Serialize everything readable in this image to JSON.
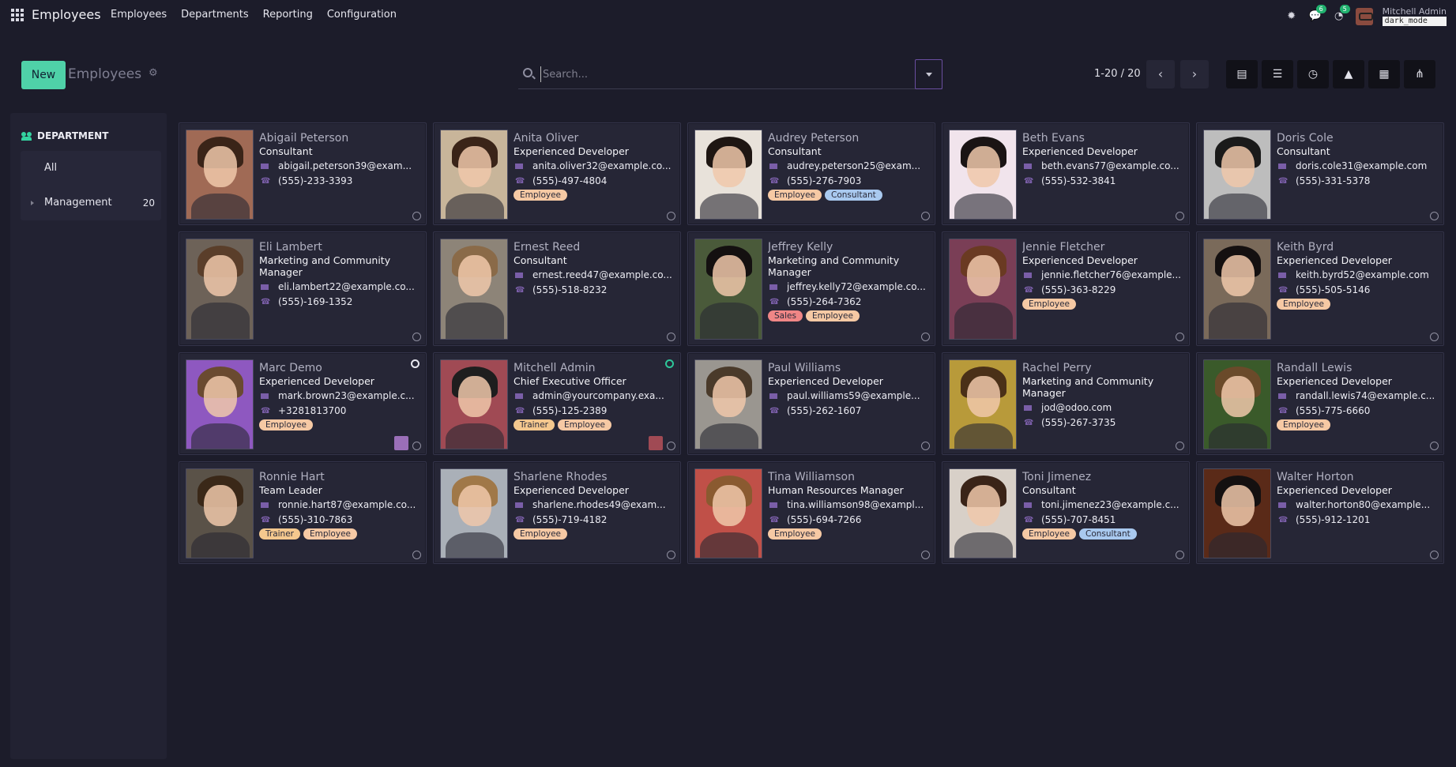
{
  "app": {
    "title": "Employees"
  },
  "top_menu": [
    "Employees",
    "Departments",
    "Reporting",
    "Configuration"
  ],
  "systray": {
    "messages_count": "6",
    "activities_count": "5",
    "user_name": "Mitchell Admin",
    "db_name": "dark_mode"
  },
  "control": {
    "new_label": "New",
    "breadcrumb": "Employees",
    "search_placeholder": "Search...",
    "pager": "1-20 / 20"
  },
  "sidepanel": {
    "header": "DEPARTMENT",
    "items": [
      {
        "label": "All",
        "count": ""
      },
      {
        "label": "Management",
        "count": "20"
      }
    ]
  },
  "employees": [
    {
      "name": "Abigail Peterson",
      "job": "Consultant",
      "email": "abigail.peterson39@exam...",
      "phone": "(555)-233-3393",
      "tags": [],
      "photo": "#a06a55",
      "hair": "#3a2418"
    },
    {
      "name": "Anita Oliver",
      "job": "Experienced Developer",
      "email": "anita.oliver32@example.co...",
      "phone": "(555)-497-4804",
      "tags": [
        "Employee"
      ],
      "photo": "#c8b59a",
      "hair": "#3a2418"
    },
    {
      "name": "Audrey Peterson",
      "job": "Consultant",
      "email": "audrey.peterson25@exam...",
      "phone": "(555)-276-7903",
      "tags": [
        "Employee",
        "Consultant"
      ],
      "photo": "#e8e2da",
      "hair": "#1e1612"
    },
    {
      "name": "Beth Evans",
      "job": "Experienced Developer",
      "email": "beth.evans77@example.co...",
      "phone": "(555)-532-3841",
      "tags": [],
      "photo": "#f1e4ec",
      "hair": "#1a1414"
    },
    {
      "name": "Doris Cole",
      "job": "Consultant",
      "email": "doris.cole31@example.com",
      "phone": "(555)-331-5378",
      "tags": [],
      "photo": "#bdbdbd",
      "hair": "#1a1a1a"
    },
    {
      "name": "Eli Lambert",
      "job": "Marketing and Community Manager",
      "email": "eli.lambert22@example.co...",
      "phone": "(555)-169-1352",
      "tags": [],
      "photo": "#6d6258",
      "hair": "#5a3e2a"
    },
    {
      "name": "Ernest Reed",
      "job": "Consultant",
      "email": "ernest.reed47@example.co...",
      "phone": "(555)-518-8232",
      "tags": [],
      "photo": "#8d8478",
      "hair": "#8a6a48"
    },
    {
      "name": "Jeffrey Kelly",
      "job": "Marketing and Community Manager",
      "email": "jeffrey.kelly72@example.co...",
      "phone": "(555)-264-7362",
      "tags": [
        "Sales",
        "Employee"
      ],
      "photo": "#4a5a3a",
      "hair": "#141010"
    },
    {
      "name": "Jennie Fletcher",
      "job": "Experienced Developer",
      "email": "jennie.fletcher76@example...",
      "phone": "(555)-363-8229",
      "tags": [
        "Employee"
      ],
      "photo": "#7a3e56",
      "hair": "#6a3a22"
    },
    {
      "name": "Keith Byrd",
      "job": "Experienced Developer",
      "email": "keith.byrd52@example.com",
      "phone": "(555)-505-5146",
      "tags": [
        "Employee"
      ],
      "photo": "#7a6a5a",
      "hair": "#141010"
    },
    {
      "name": "Marc Demo",
      "job": "Experienced Developer",
      "email": "mark.brown23@example.c...",
      "phone": "+3281813700",
      "tags": [
        "Employee"
      ],
      "photo": "#8e58c0",
      "hair": "#6a4a30",
      "presence": "offline",
      "mini": "#9a6fb8"
    },
    {
      "name": "Mitchell Admin",
      "job": "Chief Executive Officer",
      "email": "admin@yourcompany.exa...",
      "phone": "(555)-125-2389",
      "tags": [
        "Trainer",
        "Employee"
      ],
      "photo": "#a04a54",
      "hair": "#1e1e1e",
      "presence": "online",
      "mini": "#a04a54"
    },
    {
      "name": "Paul Williams",
      "job": "Experienced Developer",
      "email": "paul.williams59@example...",
      "phone": "(555)-262-1607",
      "tags": [],
      "photo": "#9a9690",
      "hair": "#4a3a2a"
    },
    {
      "name": "Rachel Perry",
      "job": "Marketing and Community Manager",
      "email": "jod@odoo.com",
      "phone": "(555)-267-3735",
      "tags": [],
      "photo": "#b89a3a",
      "hair": "#4a3018"
    },
    {
      "name": "Randall Lewis",
      "job": "Experienced Developer",
      "email": "randall.lewis74@example.c...",
      "phone": "(555)-775-6660",
      "tags": [
        "Employee"
      ],
      "photo": "#3a5a2a",
      "hair": "#6a4a2a"
    },
    {
      "name": "Ronnie Hart",
      "job": "Team Leader",
      "email": "ronnie.hart87@example.co...",
      "phone": "(555)-310-7863",
      "tags": [
        "Trainer",
        "Employee"
      ],
      "photo": "#5a5248",
      "hair": "#3a2818"
    },
    {
      "name": "Sharlene Rhodes",
      "job": "Experienced Developer",
      "email": "sharlene.rhodes49@exam...",
      "phone": "(555)-719-4182",
      "tags": [
        "Employee"
      ],
      "photo": "#aab0b8",
      "hair": "#a07848"
    },
    {
      "name": "Tina Williamson",
      "job": "Human Resources Manager",
      "email": "tina.williamson98@exampl...",
      "phone": "(555)-694-7266",
      "tags": [
        "Employee"
      ],
      "photo": "#c05048",
      "hair": "#8a5a30"
    },
    {
      "name": "Toni Jimenez",
      "job": "Consultant",
      "email": "toni.jimenez23@example.c...",
      "phone": "(555)-707-8451",
      "tags": [
        "Employee",
        "Consultant"
      ],
      "photo": "#d8d0c8",
      "hair": "#3a2418"
    },
    {
      "name": "Walter Horton",
      "job": "Experienced Developer",
      "email": "walter.horton80@example...",
      "phone": "(555)-912-1201",
      "tags": [],
      "photo": "#5a2a18",
      "hair": "#141010"
    }
  ],
  "colors": {
    "accent": "#4fd1a8",
    "background": "#1c1c2a",
    "card": "#262636",
    "icon_purple": "#7a5ea8",
    "online": "#2ec79a"
  }
}
